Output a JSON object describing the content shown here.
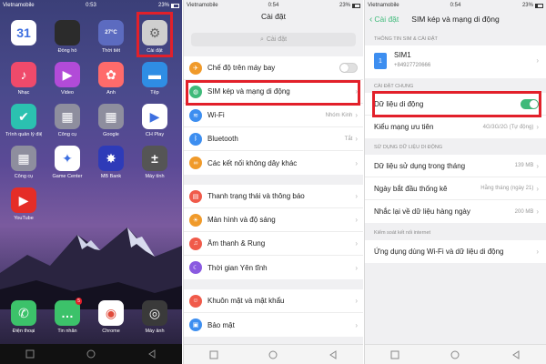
{
  "home": {
    "status": {
      "carrier": "Vietnamobile",
      "time": "0:53",
      "battery": "23%"
    },
    "apps": [
      {
        "label": "",
        "icon": "calendar-icon",
        "glyph": "31",
        "color": "#ffffff"
      },
      {
        "label": "Đồng hồ",
        "icon": "clock-icon",
        "glyph": "",
        "color": "#2b2b2b"
      },
      {
        "label": "Thời tiết",
        "icon": "weather-icon",
        "glyph": "27°C",
        "color": "#5c6bc0"
      },
      {
        "label": "Cài đặt",
        "icon": "gear-icon",
        "glyph": "⚙",
        "color": "#cfcfcf"
      },
      {
        "label": "Nhạc",
        "icon": "music-icon",
        "glyph": "♪",
        "color": "#ef4a6b"
      },
      {
        "label": "Video",
        "icon": "video-icon",
        "glyph": "▶",
        "color": "#b24bd8"
      },
      {
        "label": "Ảnh",
        "icon": "photos-icon",
        "glyph": "✿",
        "color": "#ff6b6b"
      },
      {
        "label": "Tệp",
        "icon": "files-icon",
        "glyph": "▬",
        "color": "#2f8de4"
      },
      {
        "label": "Trình quản lý điện thoại",
        "icon": "shield-icon",
        "glyph": "✔",
        "color": "#2bc1b0"
      },
      {
        "label": "Công cụ",
        "icon": "tools-folder-icon",
        "glyph": "▦",
        "color": "#8e8e9e"
      },
      {
        "label": "Google",
        "icon": "google-folder-icon",
        "glyph": "▦",
        "color": "#8e8e9e"
      },
      {
        "label": "CH Play",
        "icon": "play-store-icon",
        "glyph": "▶",
        "color": "#ffffff"
      },
      {
        "label": "Công cụ",
        "icon": "tools-folder-icon",
        "glyph": "▦",
        "color": "#8e8e9e"
      },
      {
        "label": "Game Center",
        "icon": "game-center-icon",
        "glyph": "✦",
        "color": "#ffffff"
      },
      {
        "label": "MB Bank",
        "icon": "mbbank-icon",
        "glyph": "✸",
        "color": "#2e3bb8"
      },
      {
        "label": "Máy tính",
        "icon": "calculator-icon",
        "glyph": "±",
        "color": "#555555"
      },
      {
        "label": "YouTube",
        "icon": "youtube-icon",
        "glyph": "▶",
        "color": "#e52d27"
      }
    ],
    "dock": [
      {
        "label": "Điện thoại",
        "icon": "phone-icon",
        "glyph": "✆",
        "color": "#3cc26a"
      },
      {
        "label": "Tin nhắn",
        "icon": "messages-icon",
        "glyph": "…",
        "color": "#3cc26a",
        "badge": "5"
      },
      {
        "label": "Chrome",
        "icon": "chrome-icon",
        "glyph": "◉",
        "color": "#ffffff"
      },
      {
        "label": "Máy ảnh",
        "icon": "camera-icon",
        "glyph": "◎",
        "color": "#3a3a3a"
      }
    ]
  },
  "settings": {
    "status": {
      "carrier": "Vietnamobile",
      "time": "0:54",
      "battery": "23%"
    },
    "title": "Cài đặt",
    "search_placeholder": "Cài đặt",
    "group1": [
      {
        "label": "Chế độ trên máy bay",
        "icon": "airplane-icon",
        "color": "#f09a2a",
        "value": "",
        "toggle": "off"
      },
      {
        "label": "SIM kép và mạng di động",
        "icon": "globe-icon",
        "color": "#3fba7a",
        "value": "",
        "toggle": ""
      },
      {
        "label": "Wi-Fi",
        "icon": "wifi-icon",
        "color": "#3d8ef0",
        "value": "Nhóm Kinh",
        "toggle": ""
      },
      {
        "label": "Bluetooth",
        "icon": "bluetooth-icon",
        "color": "#3d8ef0",
        "value": "Tắt",
        "toggle": ""
      },
      {
        "label": "Các kết nối không dây khác",
        "icon": "link-icon",
        "color": "#f09a2a",
        "value": "",
        "toggle": ""
      }
    ],
    "group2": [
      {
        "label": "Thanh trạng thái và thông báo",
        "icon": "notification-icon",
        "color": "#f05a4a",
        "value": ""
      },
      {
        "label": "Màn hình và độ sáng",
        "icon": "brightness-icon",
        "color": "#f09a2a",
        "value": ""
      },
      {
        "label": "Âm thanh & Rung",
        "icon": "sound-icon",
        "color": "#f05a4a",
        "value": ""
      },
      {
        "label": "Thời gian Yên tĩnh",
        "icon": "moon-icon",
        "color": "#8a5ae0",
        "value": ""
      }
    ],
    "group3": [
      {
        "label": "Khuôn mặt và mật khẩu",
        "icon": "face-icon",
        "color": "#f05a4a",
        "value": ""
      },
      {
        "label": "Bảo mật",
        "icon": "lock-icon",
        "color": "#3d8ef0",
        "value": ""
      }
    ]
  },
  "sim": {
    "status": {
      "carrier": "Vietnamobile",
      "time": "0:54",
      "battery": "23%"
    },
    "back_label": "Cài đặt",
    "title": "SIM kép và mạng di động",
    "sec_sim": "THÔNG TIN SIM & CÀI ĐẶT",
    "sim_name": "SIM1",
    "sim_number": "+84927720666",
    "sec_general": "CÀI ĐẶT CHUNG",
    "general": [
      {
        "label": "Dữ liệu di động",
        "value": "",
        "toggle": "on"
      },
      {
        "label": "Kiểu mạng ưu tiên",
        "value": "4G/3G/2G (Tự động)",
        "toggle": ""
      }
    ],
    "sec_usage": "SỬ DỤNG DỮ LIỆU DI ĐỘNG",
    "usage": [
      {
        "label": "Dữ liệu sử dụng trong tháng",
        "value": "139 MB"
      },
      {
        "label": "Ngày bắt đầu thống kê",
        "value": "Hằng tháng (ngày 21)"
      },
      {
        "label": "Nhắc lại về dữ liệu hàng ngày",
        "value": "200 MB"
      }
    ],
    "sec_internet": "Kiểm soát kết nối internet",
    "internet": [
      {
        "label": "Ứng dụng dùng Wi-Fi và dữ liệu di động",
        "value": ""
      }
    ]
  },
  "highlight_color": "#e2202a"
}
